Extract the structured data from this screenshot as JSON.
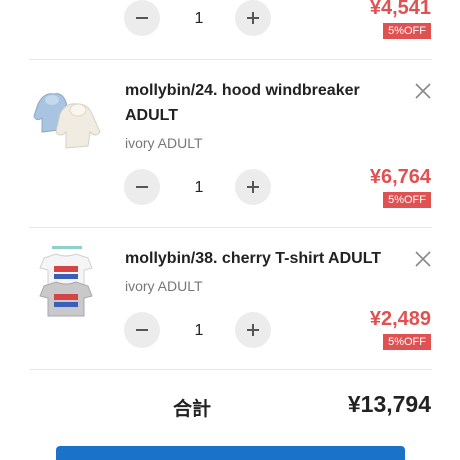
{
  "cart": {
    "items": [
      {
        "name": "",
        "variant": "",
        "quantity": "1",
        "price": "¥4,541",
        "discount": "5%OFF",
        "minus_icon": "minus-icon",
        "plus_icon": "plus-icon"
      },
      {
        "name": "mollybin/24. hood windbreaker ADULT",
        "variant": "ivory ADULT",
        "quantity": "1",
        "price": "¥6,764",
        "discount": "5%OFF",
        "remove_icon": "close-icon"
      },
      {
        "name": "mollybin/38. cherry T-shirt ADULT",
        "variant": "ivory ADULT",
        "quantity": "1",
        "price": "¥2,489",
        "discount": "5%OFF",
        "remove_icon": "close-icon"
      }
    ],
    "total_label": "合計",
    "total_amount": "¥13,794"
  },
  "colors": {
    "price_red": "#e05252",
    "button_gray": "#ececec",
    "checkout_blue": "#1a73c9"
  }
}
